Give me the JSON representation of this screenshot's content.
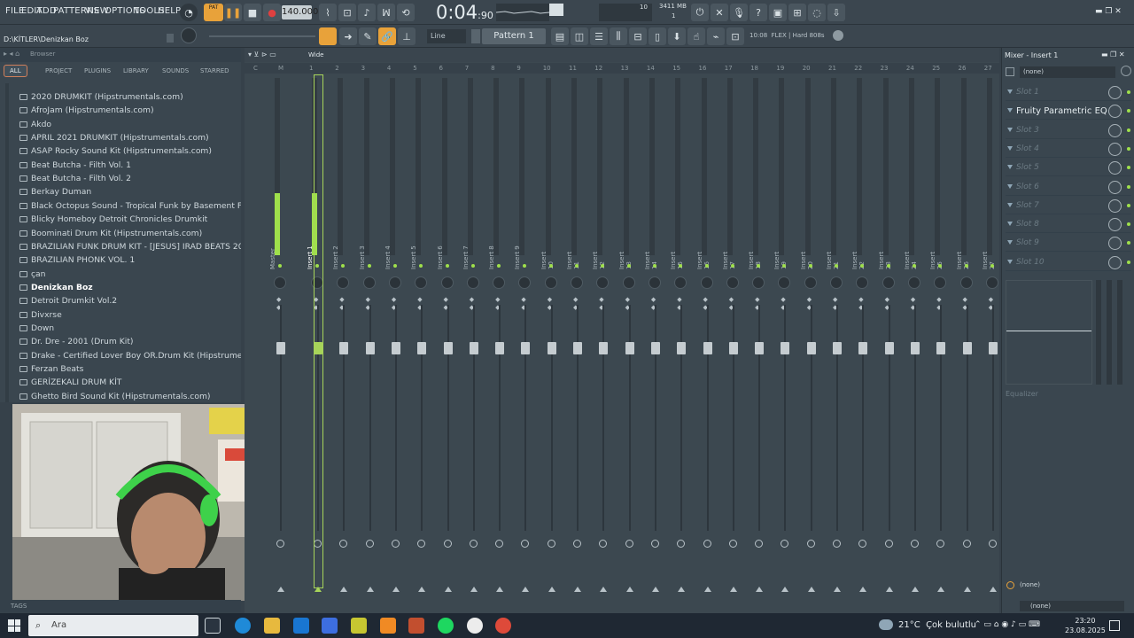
{
  "menu": [
    "FILE",
    "EDIT",
    "ADD",
    "PATTERNS",
    "VIEW",
    "OPTIONS",
    "TOOLS",
    "HELP"
  ],
  "transport": {
    "pat_song": "PAT",
    "tempo": "140.000",
    "time_main": "0:04",
    "time_sub": "90",
    "cpu_value": "10",
    "memory": "3411 MB",
    "poly": "1"
  },
  "hint_bar": "D:\\KİTLER\\Denizkan Boz",
  "toolbar": {
    "snap": "Line",
    "pattern": "Pattern 1",
    "time_small": "10:08",
    "preset": "FLEX | Hard 808s"
  },
  "browser": {
    "title": "Browser",
    "tabs": [
      "ALL",
      "PROJECT",
      "PLUGINS",
      "LIBRARY",
      "SOUNDS",
      "STARRED"
    ],
    "folders": [
      "2020 DRUMKIT (Hipstrumentals.com)",
      "AfroJam (Hipstrumentals.com)",
      "Akdo",
      "APRIL 2021 DRUMKIT (Hipstrumentals.com)",
      "ASAP Rocky Sound Kit (Hipstrumentals.com)",
      "Beat Butcha - Filth Vol. 1",
      "Beat Butcha - Filth Vol. 2",
      "Berkay Duman",
      "Black Octopus Sound - Tropical Funk by Basement Freaks",
      "Blicky Homeboy Detroit Chronicles Drumkit",
      "Boominati Drum Kit (Hipstrumentals.com)",
      "BRAZILIAN FUNK DRUM KIT - [JESUS] IRAD BEATS 2024",
      "BRAZILIAN PHONK VOL. 1",
      "çan",
      "Denizkan Boz",
      "Detroit Drumkit Vol.2",
      "Divxrse",
      "Down",
      "Dr. Dre - 2001 (Drum Kit)",
      "Drake - Certified Lover Boy OR.Drum Kit (Hipstrumentals.com)",
      "Ferzan Beats",
      "GERİZEKALI DRUM KİT",
      "Ghetto Bird Sound Kit (Hipstrumentals.com)"
    ],
    "selected_folder": "Denizkan Boz",
    "tags_label": "TAGS"
  },
  "mixer": {
    "view_mode": "Wide",
    "ruler": [
      "C",
      "M",
      "1",
      "2",
      "3",
      "4",
      "5",
      "6",
      "7",
      "8",
      "9",
      "10",
      "11",
      "12",
      "13",
      "14",
      "15",
      "16",
      "17",
      "18",
      "19",
      "20",
      "21",
      "22",
      "23",
      "24",
      "25",
      "26",
      "27"
    ],
    "tracks": [
      "Master",
      "Insert 1",
      "Insert 2",
      "Insert 3",
      "Insert 4",
      "Insert 5",
      "Insert 6",
      "Insert 7",
      "Insert 8",
      "Insert 9",
      "Insert 10",
      "Insert 11",
      "Insert 12",
      "Insert 13",
      "Insert 14",
      "Insert 15",
      "Insert 16",
      "Insert 17",
      "Insert 18",
      "Insert 19",
      "Insert 20",
      "Insert 21",
      "Insert 22",
      "Insert 23",
      "Insert 24",
      "Insert 25",
      "Insert 26",
      "Insert 27"
    ],
    "selected_track": "Insert 1"
  },
  "insert_panel": {
    "title": "Mixer - Insert 1",
    "input": "(none)",
    "slots": [
      "Slot 1",
      "Fruity Parametric EQ 2",
      "Slot 3",
      "Slot 4",
      "Slot 5",
      "Slot 6",
      "Slot 7",
      "Slot 8",
      "Slot 9",
      "Slot 10"
    ],
    "eq_label": "Equalizer",
    "output_1": "(none)",
    "output_2": "(none)"
  },
  "taskbar": {
    "search_placeholder": "Ara",
    "temperature": "21°C",
    "weather": "Çok bulutlu",
    "time": "23:20",
    "date": "23.08.2025"
  },
  "colors": {
    "accent_green": "#9fe04b",
    "accent_orange": "#d07f5a",
    "background": "#36414a"
  }
}
